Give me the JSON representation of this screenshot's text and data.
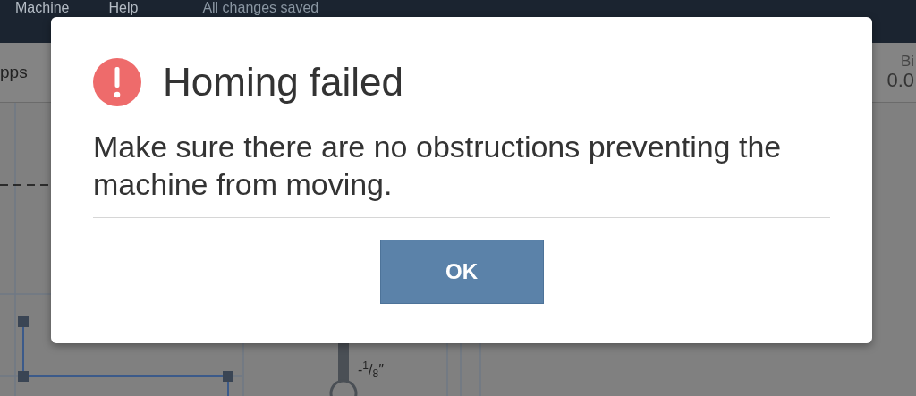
{
  "menu": [
    {
      "label": "Machine"
    },
    {
      "label": "Help"
    }
  ],
  "save_status": "All changes saved",
  "toolbar": {
    "left_label": "pps",
    "right_label": "Bi",
    "right_value": "0.0"
  },
  "canvas": {
    "offset_label": "-$^{1}$/$_{8}$″"
  },
  "dialog": {
    "kind": "error",
    "title": "Homing failed",
    "message": "Make sure there are no obstructions preventing the machine from moving.",
    "buttons": [
      {
        "label": "OK"
      }
    ]
  }
}
